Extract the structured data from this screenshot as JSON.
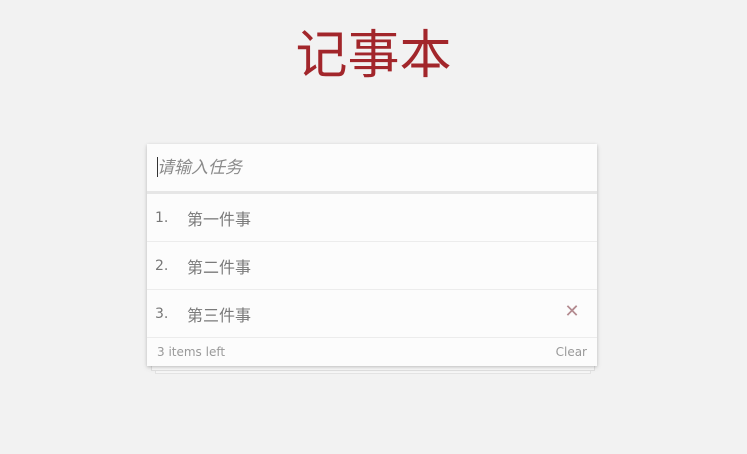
{
  "app": {
    "title": "记事本"
  },
  "new_task": {
    "placeholder": "请输入任务",
    "value": ""
  },
  "todos": [
    {
      "index": "1.",
      "text": "第一件事"
    },
    {
      "index": "2.",
      "text": "第二件事"
    },
    {
      "index": "3.",
      "text": "第三件事"
    }
  ],
  "delete_icon": {
    "icon": "close-icon",
    "glyph": "✕",
    "color": "#b38a8f"
  },
  "footer": {
    "items_left": "3 items left",
    "clear_label": "Clear"
  },
  "colors": {
    "title": "#a2262b",
    "background": "#f2f2f2",
    "card": "#fcfcfc"
  }
}
